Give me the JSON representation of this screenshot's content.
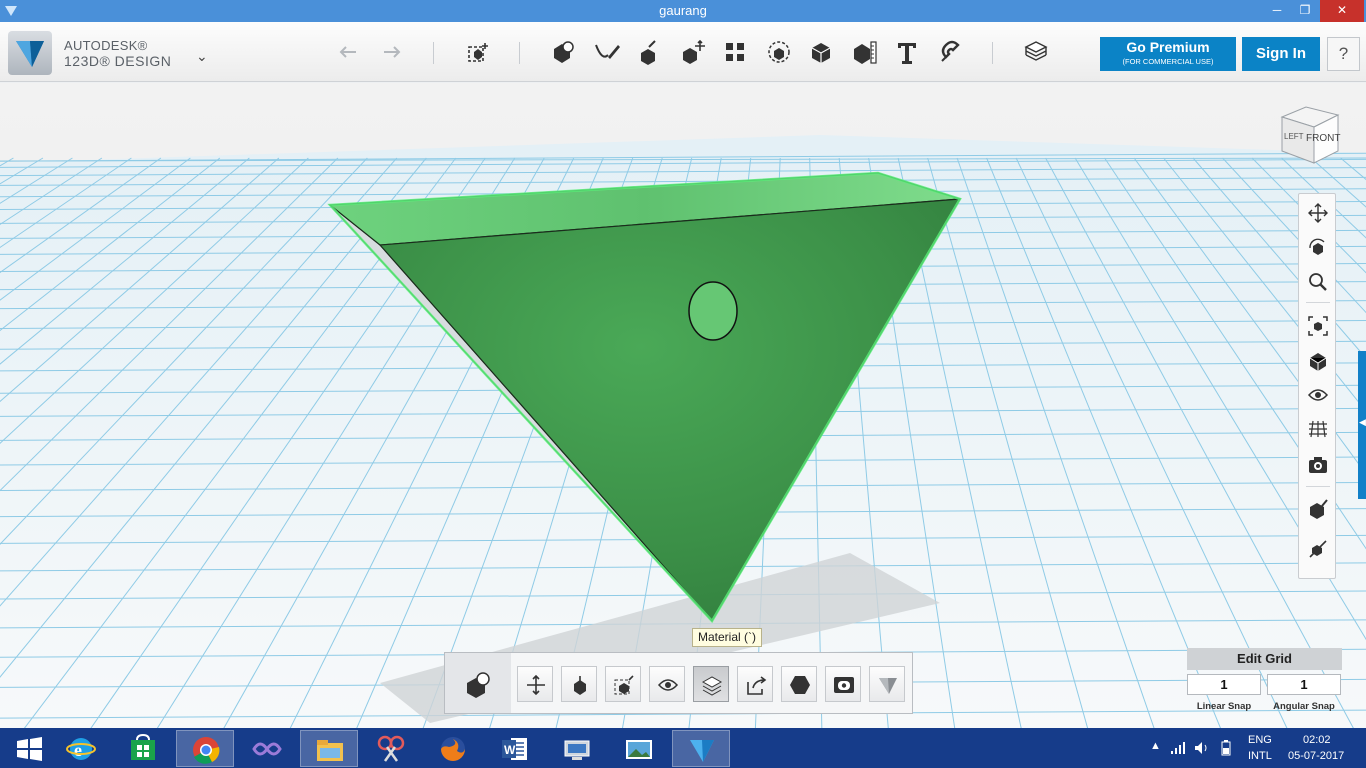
{
  "window": {
    "title": "gaurang",
    "minimize_label": "─",
    "maximize_label": "❐",
    "close_label": "✕"
  },
  "app": {
    "brand_line1": "AUTODESK®",
    "brand_line2": "123D® DESIGN",
    "menu_chevron": "⌄"
  },
  "toolbar": {
    "tools": [
      "undo-icon",
      "redo-icon",
      "transform-icon",
      "primitives-icon",
      "sketch-icon",
      "construct-icon",
      "modify-icon",
      "pattern-icon",
      "group-icon",
      "combine-icon",
      "measure-icon",
      "text-icon",
      "snap-icon",
      "material-icon"
    ],
    "premium_label": "Go Premium",
    "premium_sublabel": "(FOR COMMERCIAL USE)",
    "signin_label": "Sign In",
    "help_label": "?"
  },
  "viewcube": {
    "left_label": "LEFT",
    "front_label": "FRONT"
  },
  "nav_tools": [
    "pan-icon",
    "orbit-icon",
    "zoom-icon",
    "fit-icon",
    "views-icon",
    "visibility-icon",
    "grid-icon",
    "camera-icon",
    "material-icon",
    "snap-icon"
  ],
  "tooltip": {
    "text": "Material (`)"
  },
  "bottom_tools": [
    "move-icon",
    "smart-scale-icon",
    "scale-icon",
    "hide-icon",
    "material-icon",
    "export-icon",
    "solid-icon",
    "screenshot-icon",
    "logo-icon"
  ],
  "grid": {
    "title": "Edit Grid",
    "linear_snap_value": "1",
    "angular_snap_value": "1",
    "linear_snap_label": "Linear Snap",
    "angular_snap_label": "Angular Snap"
  },
  "colors": {
    "accent": "#0b83c6",
    "model_fill": "#3f9a4c",
    "model_edge": "#5cf07a",
    "taskbar": "#163c8a"
  },
  "taskbar": {
    "apps": [
      "windows-start-icon",
      "internet-explorer-icon",
      "store-icon",
      "chrome-icon",
      "visual-studio-icon",
      "file-explorer-icon",
      "snipping-tool-icon",
      "firefox-icon",
      "word-icon",
      "remote-desktop-icon",
      "photos-icon",
      "123d-design-icon"
    ],
    "lang_line1": "ENG",
    "lang_line2": "INTL",
    "time": "02:02",
    "date": "05-07-2017"
  }
}
